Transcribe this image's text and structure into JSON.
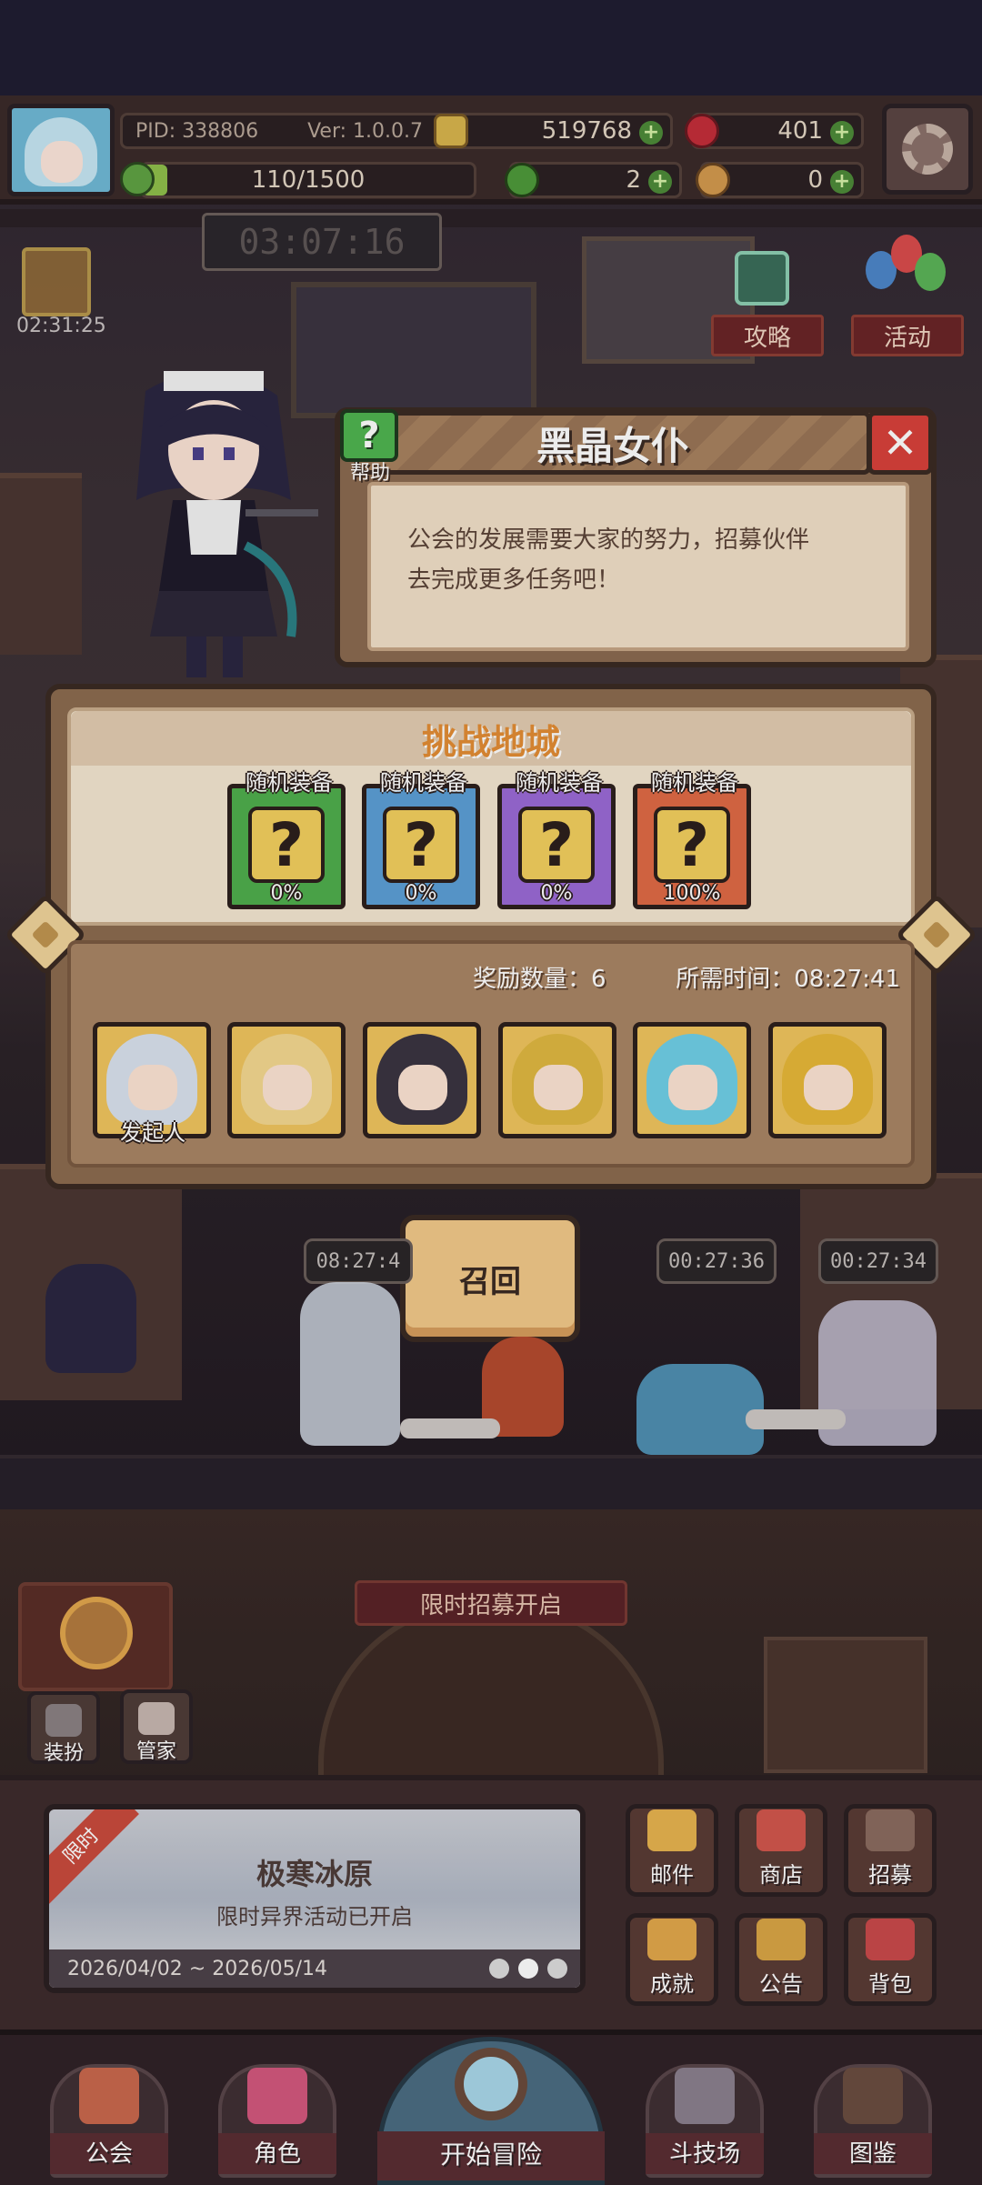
{
  "status": {
    "pid_label": "PID: 338806",
    "version_label": "Ver: 1.0.0.7",
    "coins": "519768",
    "gems": "401",
    "stamina": "110/1500",
    "stamina_fraction": 0.073,
    "clovers": "2",
    "chicken": "0"
  },
  "timers": {
    "quest_timer": "03:07:16",
    "gift_timer": "02:31:25",
    "worker_1": "08:27:4",
    "worker_2": "00:27:36",
    "worker_3": "00:27:34"
  },
  "side_buttons": {
    "guide": "攻略",
    "events": "活动"
  },
  "dialog": {
    "help_label": "帮助",
    "title": "黑晶女仆",
    "message_line1": "公会的发展需要大家的努力，招募伙伴",
    "message_line2": "去完成更多任务吧！"
  },
  "dungeon": {
    "title": "挑战地城",
    "rewards": [
      {
        "label": "随机装备",
        "percent": "0%",
        "color": "#4fae4c"
      },
      {
        "label": "随机装备",
        "percent": "0%",
        "color": "#5c9fd6"
      },
      {
        "label": "随机装备",
        "percent": "0%",
        "color": "#9b6ad6"
      },
      {
        "label": "随机装备",
        "percent": "100%",
        "color": "#e06a45"
      }
    ],
    "reward_count": "奖励数量：6",
    "required_time": "所需时间：08:27:41",
    "initiator_label": "发起人",
    "heroes": [
      {
        "name": "hero-silver",
        "hair": "#d9e2ee",
        "bg": "#f0c55e"
      },
      {
        "name": "hero-blonde",
        "hair": "#f5d890",
        "bg": "#f0c55e"
      },
      {
        "name": "hero-dark",
        "hair": "#3a3340",
        "bg": "#f0c55e"
      },
      {
        "name": "hero-gold-1",
        "hair": "#e0b840",
        "bg": "#f0c55e"
      },
      {
        "name": "hero-cyan",
        "hair": "#6fd0e8",
        "bg": "#f0c55e"
      },
      {
        "name": "hero-gold-2",
        "hair": "#e8b838",
        "bg": "#f0c55e"
      }
    ]
  },
  "recall_button": "召回",
  "hall_banner": "限时招募开启",
  "small_buttons": {
    "dress": "装扮",
    "butler": "管家"
  },
  "event_banner": {
    "ribbon": "限时",
    "title": "极寒冰原",
    "subtitle": "限时异界活动已开启",
    "date_range": "2026/04/02 ~ 2026/05/14"
  },
  "grid_buttons": [
    {
      "label": "邮件",
      "color": "#e8b34f"
    },
    {
      "label": "商店",
      "color": "#d2564c"
    },
    {
      "label": "招募",
      "color": "#8a6b5f"
    },
    {
      "label": "成就",
      "color": "#e2a84a"
    },
    {
      "label": "公告",
      "color": "#d9a545"
    },
    {
      "label": "背包",
      "color": "#c9494a"
    }
  ],
  "bottom_nav": {
    "guild": "公会",
    "character": "角色",
    "adventure": "开始冒险",
    "arena": "斗技场",
    "codex": "图鉴"
  },
  "colors": {
    "panel_brown": "#8b6b4f",
    "dark_outline": "#3a2a22",
    "accent_orange": "#e38d34",
    "close_red": "#d8403a",
    "help_green": "#4fb550"
  }
}
